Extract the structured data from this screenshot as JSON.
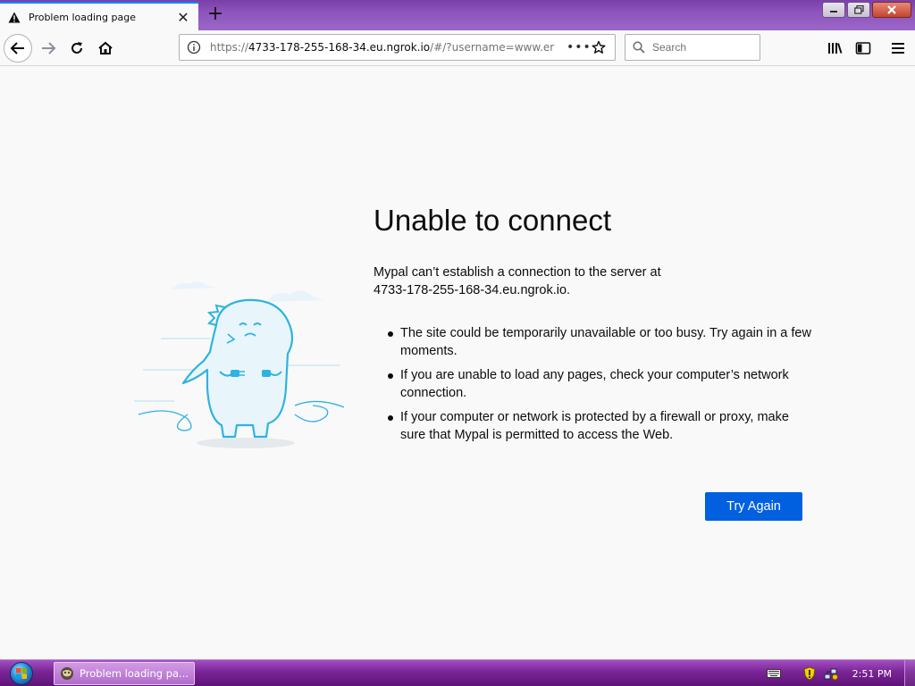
{
  "browser": {
    "tab": {
      "title": "Problem loading page",
      "close_symbol": "✕",
      "new_tab_symbol": "+"
    },
    "toolbar": {
      "url_prefix": "https://",
      "url_host": "4733-178-255-168-34.eu.ngrok.io",
      "url_rest": "/#/?username=www.er",
      "page_actions_symbol": "•••",
      "search_placeholder": "Search"
    }
  },
  "error_page": {
    "heading": "Unable to connect",
    "lead_line1": "Mypal can’t establish a connection to the server at",
    "lead_line2": "4733-178-255-168-34.eu.ngrok.io.",
    "bullets": [
      "The site could be temporarily unavailable or too busy. Try again in a few moments.",
      "If you are unable to load any pages, check your computer’s network connection.",
      "If your computer or network is protected by a firewall or proxy, make sure that Mypal is permitted to access the Web."
    ],
    "try_again_label": "Try Again"
  },
  "taskbar": {
    "task_label": "Problem loading pa...",
    "clock": "2:51 PM"
  },
  "colors": {
    "accent": "#0060df",
    "title_bar": "#8d55bd",
    "taskbar": "#7a2596",
    "illustration_stroke": "#2eb3df"
  }
}
